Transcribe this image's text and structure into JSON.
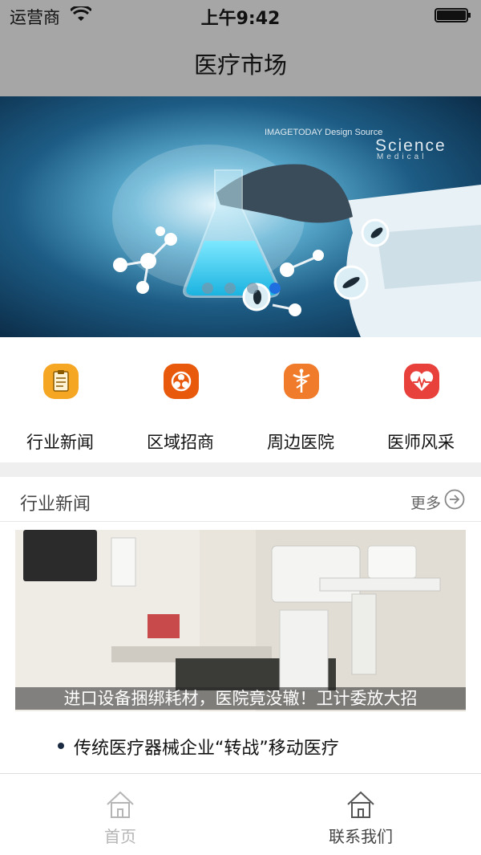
{
  "status_bar": {
    "carrier": "运营商",
    "time": "上午9:42"
  },
  "nav": {
    "title": "医疗市场"
  },
  "banner": {
    "text_top": "IMAGETODAY Design Source",
    "text_science": "Science",
    "text_medical": "Medical",
    "dots": 4,
    "active_dot": 3
  },
  "categories": [
    {
      "label": "行业新闻",
      "icon": "clipboard-icon",
      "color": "#f5a623"
    },
    {
      "label": "区域招商",
      "icon": "biohazard-icon",
      "color": "#e8590c"
    },
    {
      "label": "周边医院",
      "icon": "caduceus-icon",
      "color": "#f07b2a"
    },
    {
      "label": "医师风采",
      "icon": "heart-pulse-icon",
      "color": "#e8413c"
    }
  ],
  "section": {
    "title": "行业新闻",
    "more": "更多"
  },
  "featured": {
    "caption": "进口设备捆绑耗材，医院竟没辙！卫计委放大招"
  },
  "news_items": [
    "传统医疗器械企业“转战”移动医疗"
  ],
  "tabs": [
    {
      "label": "首页",
      "active": false
    },
    {
      "label": "联系我们",
      "active": true
    }
  ]
}
